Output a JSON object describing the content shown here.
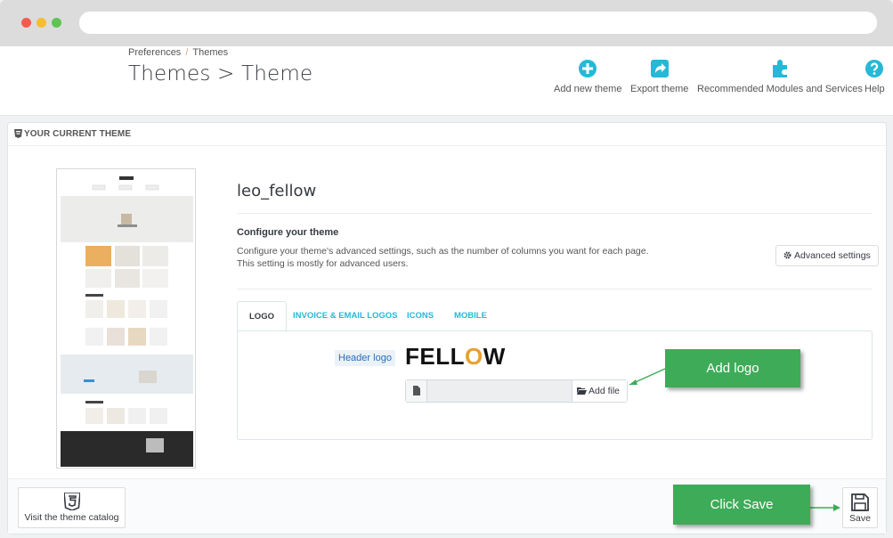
{
  "breadcrumb": {
    "parent": "Preferences",
    "separator": "/",
    "current": "Themes"
  },
  "page_title": "Themes > Theme",
  "toolbar": {
    "add_new_theme": "Add new theme",
    "export_theme": "Export theme",
    "recommended": "Recommended Modules and Services",
    "help": "Help",
    "icon_color": "#25b9d7"
  },
  "panel": {
    "heading": "YOUR CURRENT THEME",
    "theme_name": "leo_fellow",
    "configure_title": "Configure your theme",
    "configure_desc_line1": "Configure your theme's advanced settings, such as the number of columns you want for each page.",
    "configure_desc_line2": "This setting is mostly for advanced users.",
    "advanced_settings": "Advanced settings",
    "tabs": [
      {
        "label": "LOGO",
        "active": true
      },
      {
        "label": "INVOICE & EMAIL LOGOS",
        "active": false
      },
      {
        "label": "ICONS",
        "active": false
      },
      {
        "label": "MOBILE",
        "active": false
      }
    ],
    "header_logo_label": "Header logo",
    "logo_text_left": "FELL",
    "logo_text_o": "O",
    "logo_text_right": "W",
    "add_file": "Add file"
  },
  "callouts": {
    "add_logo": "Add logo",
    "click_save": "Click Save",
    "color": "#3eab58"
  },
  "footer": {
    "catalog": "Visit the theme catalog",
    "save": "Save"
  }
}
